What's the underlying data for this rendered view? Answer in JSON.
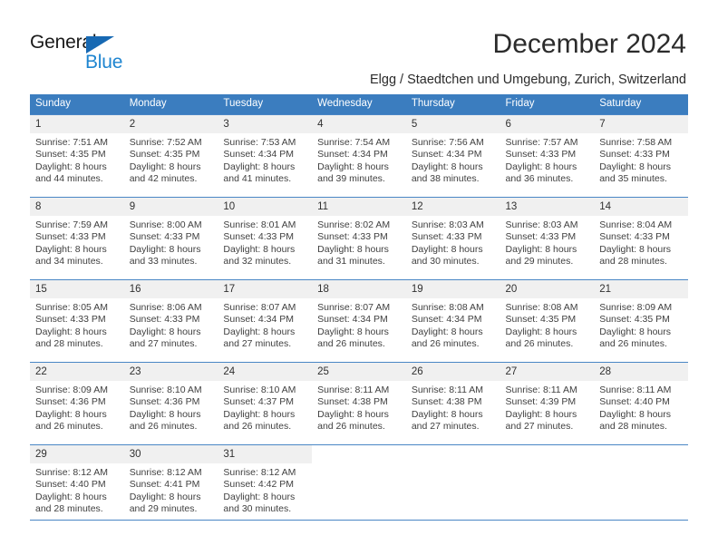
{
  "brand": {
    "name_part1": "General",
    "name_part2": "Blue",
    "color_dark": "#1a1a1a",
    "color_blue": "#1e85d0",
    "triangle_color": "#1769b3"
  },
  "header": {
    "title": "December 2024",
    "subtitle": "Elgg / Staedtchen und Umgebung, Zurich, Switzerland"
  },
  "theme": {
    "header_bg": "#3b7dbf",
    "row_rule": "#4a86c5",
    "daynum_bg": "#f0f0f0",
    "text": "#404040"
  },
  "weekdays": [
    "Sunday",
    "Monday",
    "Tuesday",
    "Wednesday",
    "Thursday",
    "Friday",
    "Saturday"
  ],
  "weeks": [
    [
      {
        "day": "1",
        "sunrise": "Sunrise: 7:51 AM",
        "sunset": "Sunset: 4:35 PM",
        "daylight1": "Daylight: 8 hours",
        "daylight2": "and 44 minutes."
      },
      {
        "day": "2",
        "sunrise": "Sunrise: 7:52 AM",
        "sunset": "Sunset: 4:35 PM",
        "daylight1": "Daylight: 8 hours",
        "daylight2": "and 42 minutes."
      },
      {
        "day": "3",
        "sunrise": "Sunrise: 7:53 AM",
        "sunset": "Sunset: 4:34 PM",
        "daylight1": "Daylight: 8 hours",
        "daylight2": "and 41 minutes."
      },
      {
        "day": "4",
        "sunrise": "Sunrise: 7:54 AM",
        "sunset": "Sunset: 4:34 PM",
        "daylight1": "Daylight: 8 hours",
        "daylight2": "and 39 minutes."
      },
      {
        "day": "5",
        "sunrise": "Sunrise: 7:56 AM",
        "sunset": "Sunset: 4:34 PM",
        "daylight1": "Daylight: 8 hours",
        "daylight2": "and 38 minutes."
      },
      {
        "day": "6",
        "sunrise": "Sunrise: 7:57 AM",
        "sunset": "Sunset: 4:33 PM",
        "daylight1": "Daylight: 8 hours",
        "daylight2": "and 36 minutes."
      },
      {
        "day": "7",
        "sunrise": "Sunrise: 7:58 AM",
        "sunset": "Sunset: 4:33 PM",
        "daylight1": "Daylight: 8 hours",
        "daylight2": "and 35 minutes."
      }
    ],
    [
      {
        "day": "8",
        "sunrise": "Sunrise: 7:59 AM",
        "sunset": "Sunset: 4:33 PM",
        "daylight1": "Daylight: 8 hours",
        "daylight2": "and 34 minutes."
      },
      {
        "day": "9",
        "sunrise": "Sunrise: 8:00 AM",
        "sunset": "Sunset: 4:33 PM",
        "daylight1": "Daylight: 8 hours",
        "daylight2": "and 33 minutes."
      },
      {
        "day": "10",
        "sunrise": "Sunrise: 8:01 AM",
        "sunset": "Sunset: 4:33 PM",
        "daylight1": "Daylight: 8 hours",
        "daylight2": "and 32 minutes."
      },
      {
        "day": "11",
        "sunrise": "Sunrise: 8:02 AM",
        "sunset": "Sunset: 4:33 PM",
        "daylight1": "Daylight: 8 hours",
        "daylight2": "and 31 minutes."
      },
      {
        "day": "12",
        "sunrise": "Sunrise: 8:03 AM",
        "sunset": "Sunset: 4:33 PM",
        "daylight1": "Daylight: 8 hours",
        "daylight2": "and 30 minutes."
      },
      {
        "day": "13",
        "sunrise": "Sunrise: 8:03 AM",
        "sunset": "Sunset: 4:33 PM",
        "daylight1": "Daylight: 8 hours",
        "daylight2": "and 29 minutes."
      },
      {
        "day": "14",
        "sunrise": "Sunrise: 8:04 AM",
        "sunset": "Sunset: 4:33 PM",
        "daylight1": "Daylight: 8 hours",
        "daylight2": "and 28 minutes."
      }
    ],
    [
      {
        "day": "15",
        "sunrise": "Sunrise: 8:05 AM",
        "sunset": "Sunset: 4:33 PM",
        "daylight1": "Daylight: 8 hours",
        "daylight2": "and 28 minutes."
      },
      {
        "day": "16",
        "sunrise": "Sunrise: 8:06 AM",
        "sunset": "Sunset: 4:33 PM",
        "daylight1": "Daylight: 8 hours",
        "daylight2": "and 27 minutes."
      },
      {
        "day": "17",
        "sunrise": "Sunrise: 8:07 AM",
        "sunset": "Sunset: 4:34 PM",
        "daylight1": "Daylight: 8 hours",
        "daylight2": "and 27 minutes."
      },
      {
        "day": "18",
        "sunrise": "Sunrise: 8:07 AM",
        "sunset": "Sunset: 4:34 PM",
        "daylight1": "Daylight: 8 hours",
        "daylight2": "and 26 minutes."
      },
      {
        "day": "19",
        "sunrise": "Sunrise: 8:08 AM",
        "sunset": "Sunset: 4:34 PM",
        "daylight1": "Daylight: 8 hours",
        "daylight2": "and 26 minutes."
      },
      {
        "day": "20",
        "sunrise": "Sunrise: 8:08 AM",
        "sunset": "Sunset: 4:35 PM",
        "daylight1": "Daylight: 8 hours",
        "daylight2": "and 26 minutes."
      },
      {
        "day": "21",
        "sunrise": "Sunrise: 8:09 AM",
        "sunset": "Sunset: 4:35 PM",
        "daylight1": "Daylight: 8 hours",
        "daylight2": "and 26 minutes."
      }
    ],
    [
      {
        "day": "22",
        "sunrise": "Sunrise: 8:09 AM",
        "sunset": "Sunset: 4:36 PM",
        "daylight1": "Daylight: 8 hours",
        "daylight2": "and 26 minutes."
      },
      {
        "day": "23",
        "sunrise": "Sunrise: 8:10 AM",
        "sunset": "Sunset: 4:36 PM",
        "daylight1": "Daylight: 8 hours",
        "daylight2": "and 26 minutes."
      },
      {
        "day": "24",
        "sunrise": "Sunrise: 8:10 AM",
        "sunset": "Sunset: 4:37 PM",
        "daylight1": "Daylight: 8 hours",
        "daylight2": "and 26 minutes."
      },
      {
        "day": "25",
        "sunrise": "Sunrise: 8:11 AM",
        "sunset": "Sunset: 4:38 PM",
        "daylight1": "Daylight: 8 hours",
        "daylight2": "and 26 minutes."
      },
      {
        "day": "26",
        "sunrise": "Sunrise: 8:11 AM",
        "sunset": "Sunset: 4:38 PM",
        "daylight1": "Daylight: 8 hours",
        "daylight2": "and 27 minutes."
      },
      {
        "day": "27",
        "sunrise": "Sunrise: 8:11 AM",
        "sunset": "Sunset: 4:39 PM",
        "daylight1": "Daylight: 8 hours",
        "daylight2": "and 27 minutes."
      },
      {
        "day": "28",
        "sunrise": "Sunrise: 8:11 AM",
        "sunset": "Sunset: 4:40 PM",
        "daylight1": "Daylight: 8 hours",
        "daylight2": "and 28 minutes."
      }
    ],
    [
      {
        "day": "29",
        "sunrise": "Sunrise: 8:12 AM",
        "sunset": "Sunset: 4:40 PM",
        "daylight1": "Daylight: 8 hours",
        "daylight2": "and 28 minutes."
      },
      {
        "day": "30",
        "sunrise": "Sunrise: 8:12 AM",
        "sunset": "Sunset: 4:41 PM",
        "daylight1": "Daylight: 8 hours",
        "daylight2": "and 29 minutes."
      },
      {
        "day": "31",
        "sunrise": "Sunrise: 8:12 AM",
        "sunset": "Sunset: 4:42 PM",
        "daylight1": "Daylight: 8 hours",
        "daylight2": "and 30 minutes."
      },
      {
        "day": "",
        "sunrise": "",
        "sunset": "",
        "daylight1": "",
        "daylight2": ""
      },
      {
        "day": "",
        "sunrise": "",
        "sunset": "",
        "daylight1": "",
        "daylight2": ""
      },
      {
        "day": "",
        "sunrise": "",
        "sunset": "",
        "daylight1": "",
        "daylight2": ""
      },
      {
        "day": "",
        "sunrise": "",
        "sunset": "",
        "daylight1": "",
        "daylight2": ""
      }
    ]
  ]
}
